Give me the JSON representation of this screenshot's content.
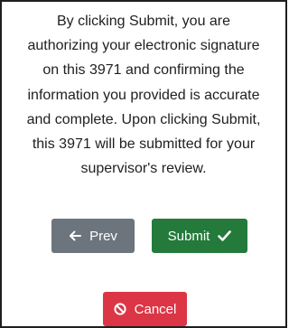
{
  "dialog": {
    "message_lines": [
      "By clicking Submit, you are",
      "authorizing your electronic signature",
      "on this 3971 and confirming the",
      "information you provided is accurate",
      "and complete. Upon clicking Submit,",
      "this 3971 will be submitted for your",
      "supervisor's review."
    ]
  },
  "buttons": {
    "prev": {
      "label": "Prev",
      "icon": "arrow-left-icon",
      "color": "#6c757d"
    },
    "submit": {
      "label": "Submit",
      "icon": "check-icon",
      "color": "#237a3b"
    },
    "cancel": {
      "label": "Cancel",
      "icon": "ban-icon",
      "color": "#dc3545"
    }
  }
}
